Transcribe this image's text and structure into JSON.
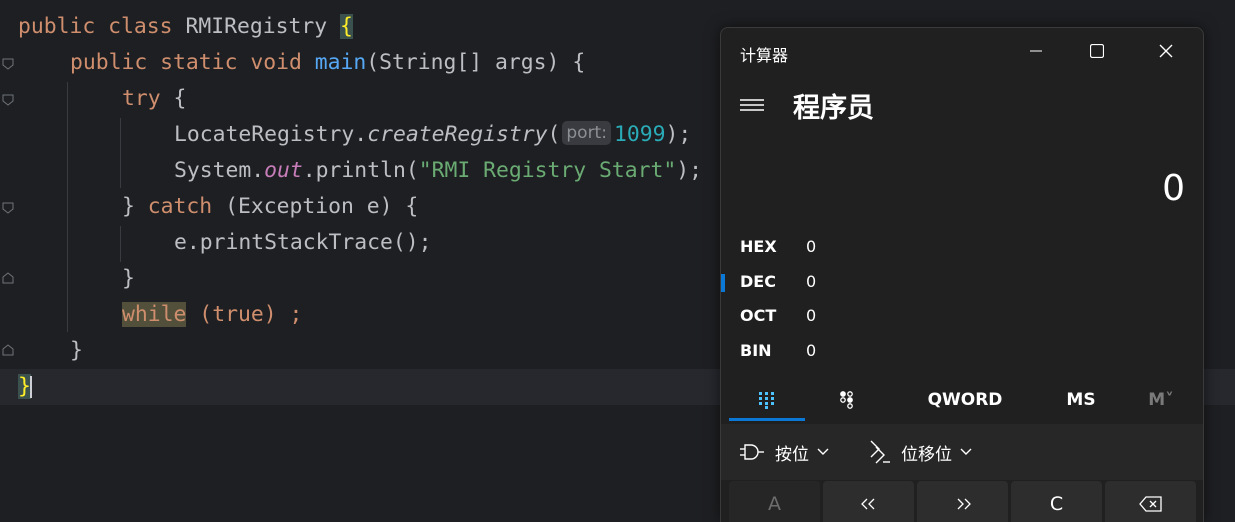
{
  "editor": {
    "code": {
      "line1": {
        "kw1": "public",
        "kw2": "class",
        "name": "RMIRegistry",
        "brace": "{"
      },
      "line2": {
        "kw1": "public",
        "kw2": "static",
        "kw3": "void",
        "method": "main",
        "args": "(String[] args)",
        "brace": "{"
      },
      "line3": {
        "kw": "try",
        "brace": "{"
      },
      "line4": {
        "cls": "LocateRegistry.",
        "method": "createRegistry",
        "open": "(",
        "hint": "port:",
        "num": "1099",
        "close": ");"
      },
      "line5": {
        "cls": "System.",
        "field": "out",
        "call": ".println(",
        "str": "\"RMI Registry Start\"",
        "close": ");"
      },
      "line6": {
        "close": "}",
        "kw": "catch",
        "params": "(Exception e)",
        "brace": "{"
      },
      "line7": {
        "call": "e.printStackTrace();"
      },
      "line8": {
        "brace": "}"
      },
      "line9": {
        "kw": "while",
        "open": "(",
        "val": "true",
        "close": ") ;"
      },
      "line10": {
        "brace": "}"
      },
      "line11": {
        "brace": "}"
      }
    },
    "colors": {
      "background": "#1e1f22",
      "keyword": "#cf8e6d",
      "method": "#56a8f5",
      "string": "#6aab73",
      "number": "#2aacb8",
      "static_field": "#c77dba",
      "text": "#bcbec4"
    }
  },
  "calculator": {
    "window_title": "计算器",
    "mode_title": "程序员",
    "display_value": "0",
    "radix": [
      {
        "label": "HEX",
        "value": "0"
      },
      {
        "label": "DEC",
        "value": "0"
      },
      {
        "label": "OCT",
        "value": "0"
      },
      {
        "label": "BIN",
        "value": "0"
      }
    ],
    "active_radix": "DEC",
    "toolbar": {
      "word_size": "QWORD",
      "memory_store": "MS",
      "memory_recall": "M˅"
    },
    "operations": {
      "bitwise": "按位",
      "bit_shift": "位移位"
    },
    "keys": [
      "A",
      "‹‹",
      "››",
      "C"
    ],
    "icons": [
      "menu-icon",
      "full-keypad-icon",
      "bit-toggle-keypad-icon",
      "logic-gate-icon",
      "bit-shift-icon",
      "backspace-icon",
      "minimize-icon",
      "maximize-icon",
      "close-icon",
      "chevron-down-icon"
    ],
    "colors": {
      "background": "#202020",
      "accent": "#0a78d4",
      "key": "#2d2d2d"
    }
  }
}
